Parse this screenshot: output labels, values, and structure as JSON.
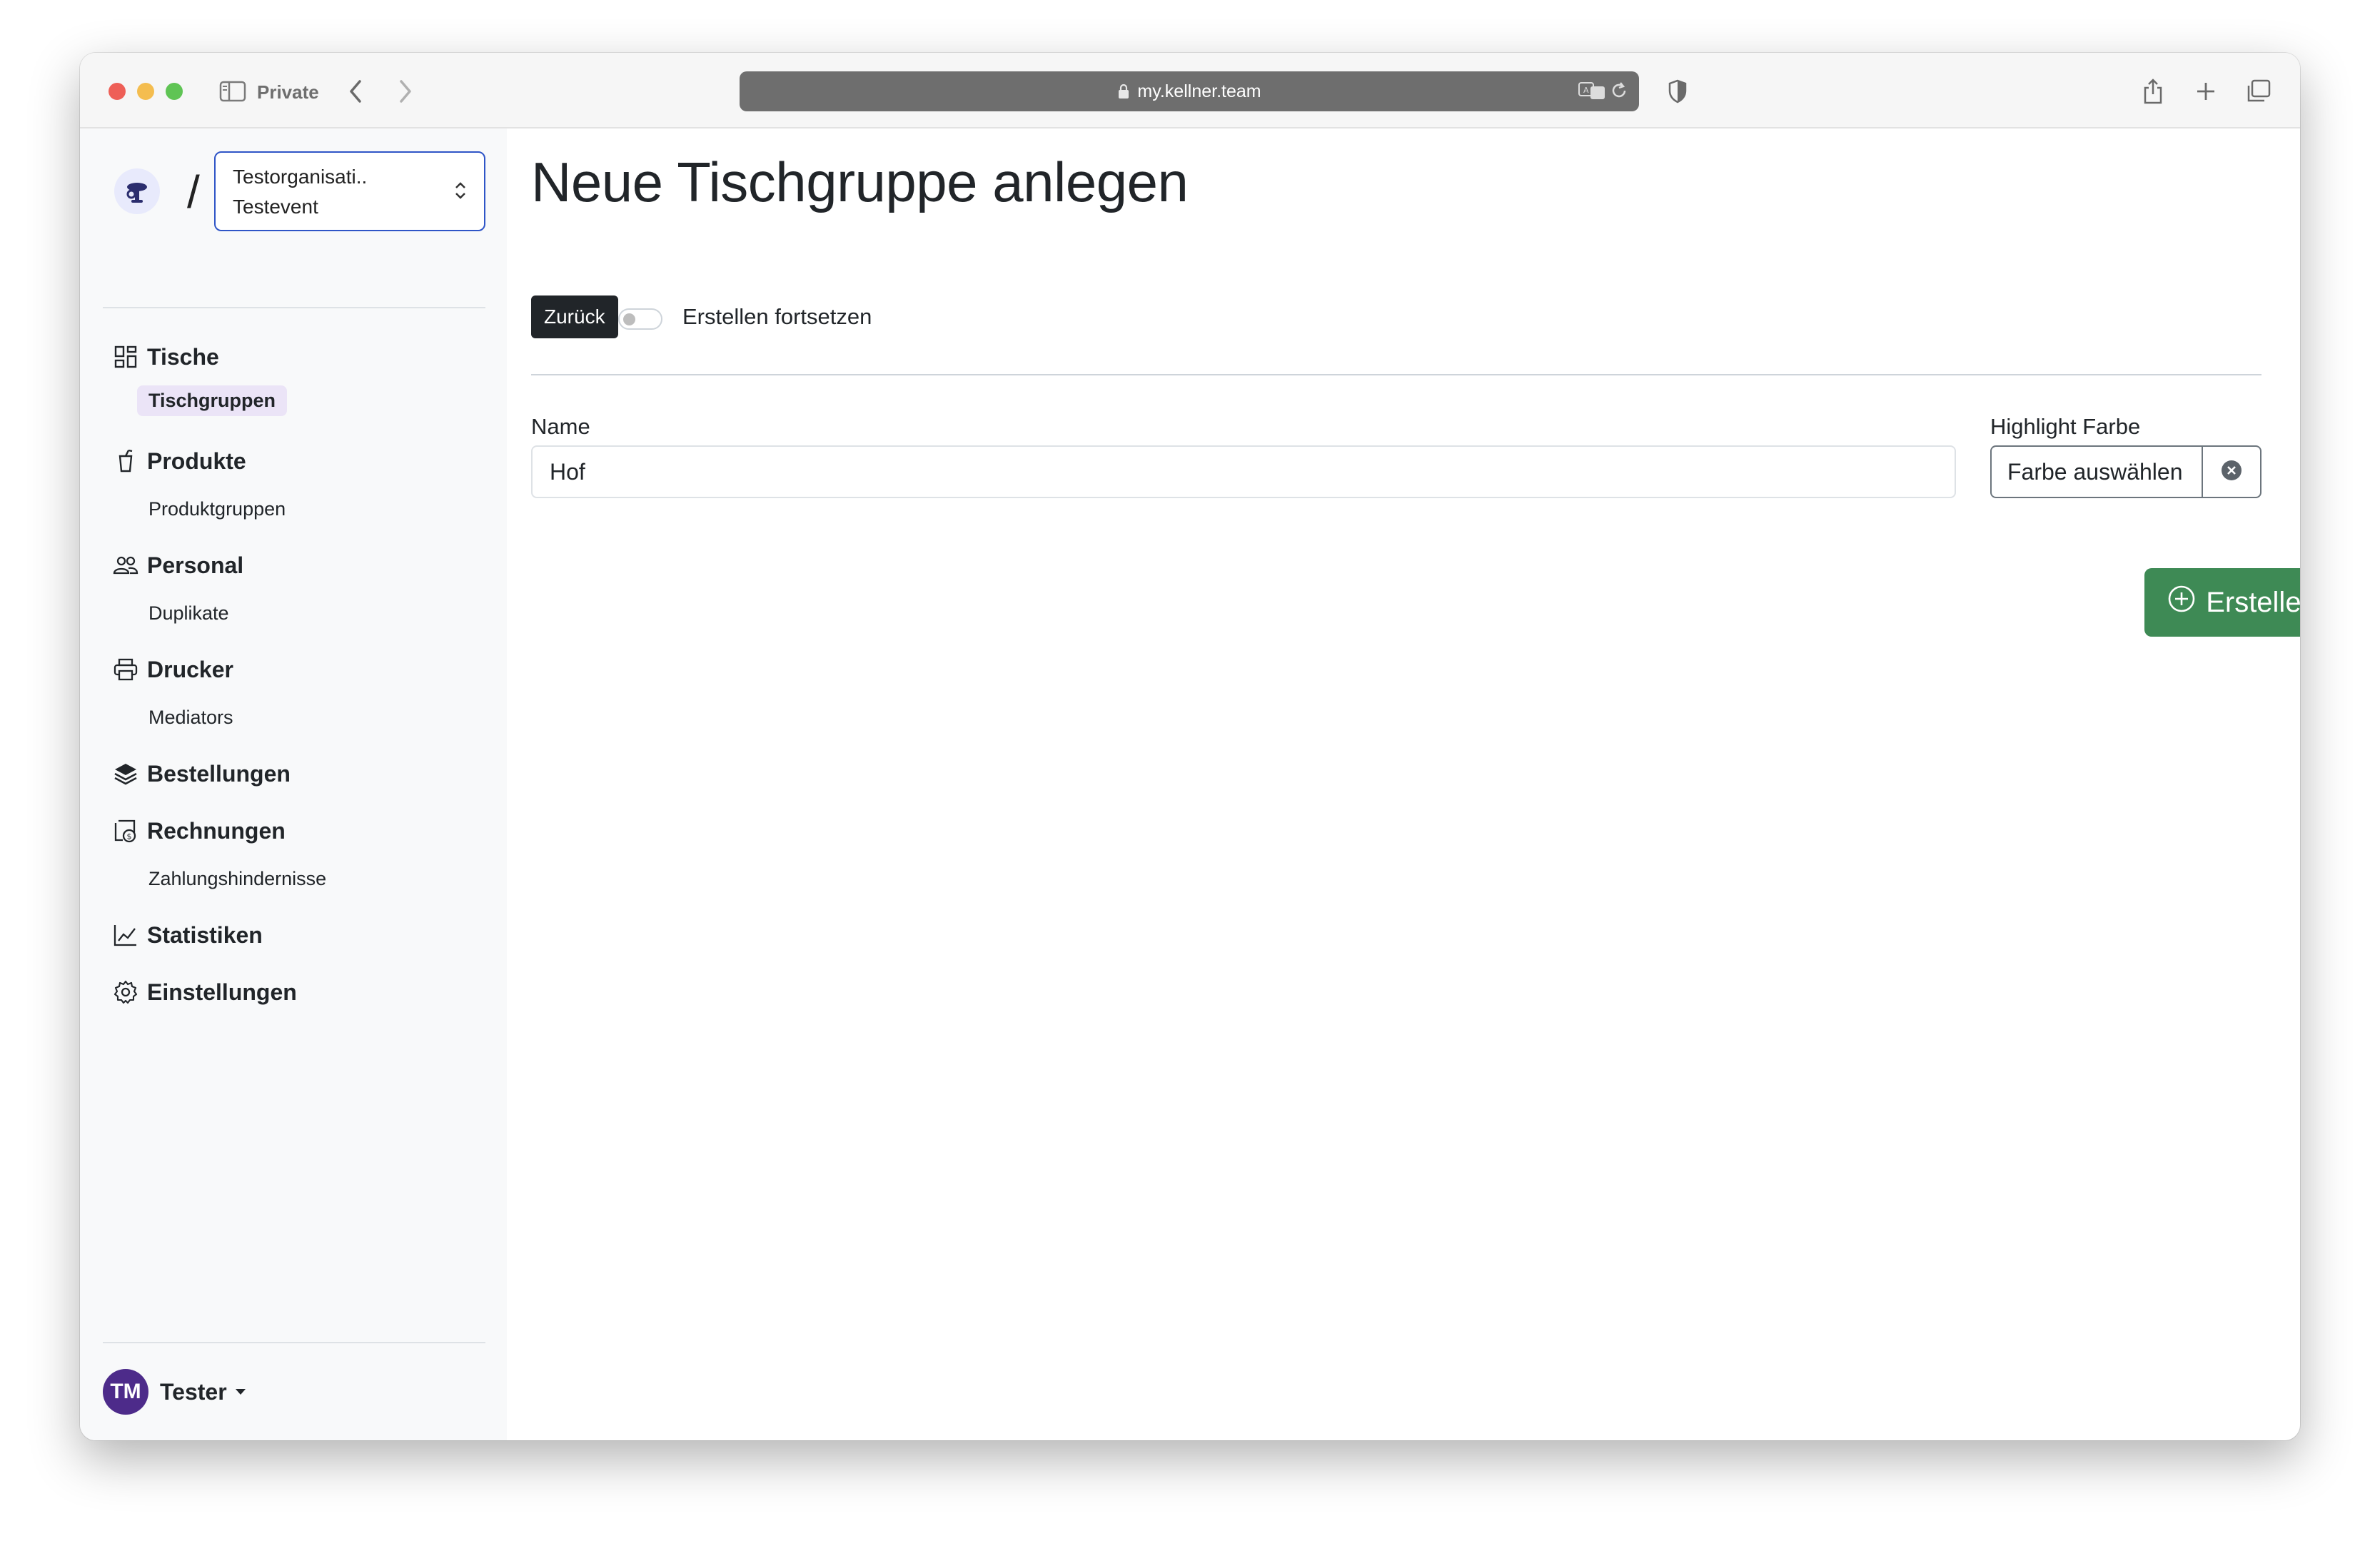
{
  "browser": {
    "private_label": "Private",
    "url": "my.kellner.team"
  },
  "sidebar": {
    "org_name": "Testorganisati..",
    "event_name": "Testevent",
    "slash": "/",
    "nav": {
      "tische": "Tische",
      "tischgruppen": "Tischgruppen",
      "produkte": "Produkte",
      "produktgruppen": "Produktgruppen",
      "personal": "Personal",
      "duplikate": "Duplikate",
      "drucker": "Drucker",
      "mediators": "Mediators",
      "bestellungen": "Bestellungen",
      "rechnungen": "Rechnungen",
      "zahlungshindernisse": "Zahlungshindernisse",
      "statistiken": "Statistiken",
      "einstellungen": "Einstellungen"
    },
    "user": {
      "initials": "TM",
      "name": "Tester"
    }
  },
  "main": {
    "title": "Neue Tischgruppe anlegen",
    "back_button": "Zurück",
    "continue_toggle_label": "Erstellen fortsetzen",
    "name_label": "Name",
    "name_value": "Hof",
    "highlight_label": "Highlight Farbe",
    "color_button": "Farbe auswählen",
    "create_button": "Erstellen"
  },
  "colors": {
    "accent": "#2f55c7",
    "active_nav_bg": "#ebe4f7",
    "create_green": "#3e8a55",
    "dark_button": "#212529",
    "user_avatar": "#4d2b8a"
  }
}
